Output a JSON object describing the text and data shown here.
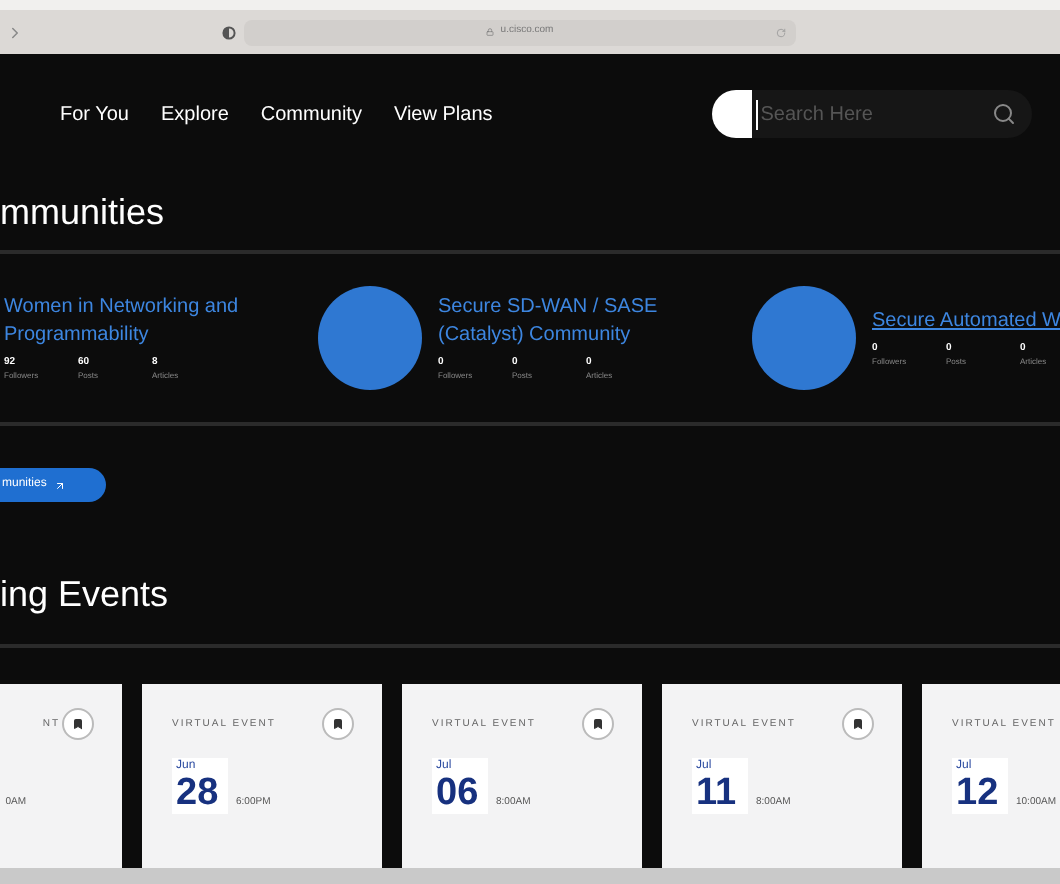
{
  "browser": {
    "url": "u.cisco.com"
  },
  "nav": {
    "links": [
      "For You",
      "Explore",
      "Community",
      "View Plans"
    ],
    "search": {
      "placeholder": "Search Here"
    }
  },
  "communities_heading": "mmunities",
  "communities": [
    {
      "title": "Women in Networking and Programmability",
      "link": false,
      "stats": [
        {
          "value": "92",
          "label": "Followers"
        },
        {
          "value": "60",
          "label": "Posts"
        },
        {
          "value": "8",
          "label": "Articles"
        }
      ]
    },
    {
      "title": "Secure SD-WAN / SASE (Catalyst) Community",
      "link": false,
      "stats": [
        {
          "value": "0",
          "label": "Followers"
        },
        {
          "value": "0",
          "label": "Posts"
        },
        {
          "value": "0",
          "label": "Articles"
        }
      ]
    },
    {
      "title": "Secure Automated W",
      "link": true,
      "stats": [
        {
          "value": "0",
          "label": "Followers"
        },
        {
          "value": "0",
          "label": "Posts"
        },
        {
          "value": "0",
          "label": "Articles"
        }
      ]
    }
  ],
  "communities_button": "munities",
  "events_heading": "ing Events",
  "events": [
    {
      "label": "NT",
      "time": "0AM"
    },
    {
      "label": "VIRTUAL EVENT",
      "month": "Jun",
      "day": "28",
      "time": "6:00PM"
    },
    {
      "label": "VIRTUAL EVENT",
      "month": "Jul",
      "day": "06",
      "time": "8:00AM"
    },
    {
      "label": "VIRTUAL EVENT",
      "month": "Jul",
      "day": "11",
      "time": "8:00AM"
    },
    {
      "label": "VIRTUAL EVENT",
      "month": "Jul",
      "day": "12",
      "time": "10:00AM"
    }
  ]
}
